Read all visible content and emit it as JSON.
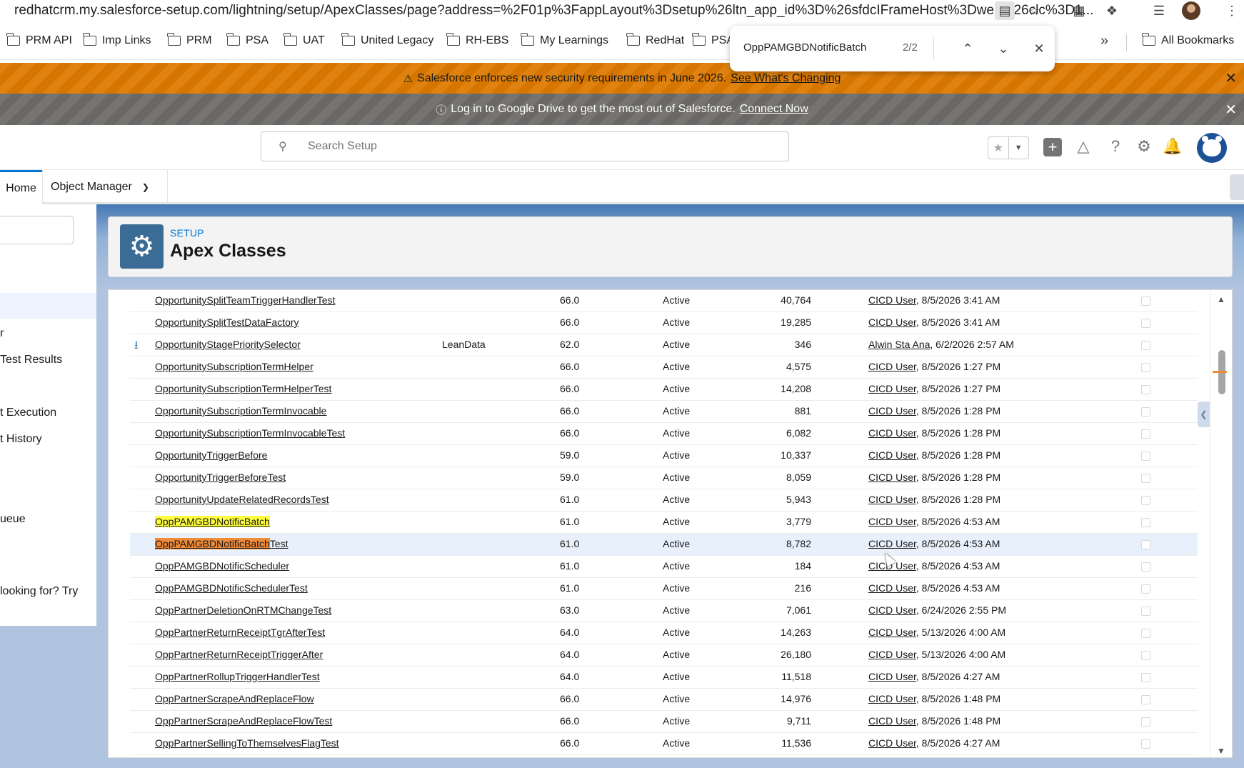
{
  "browser": {
    "url": "redhatcrm.my.salesforce-setup.com/lightning/setup/ApexClasses/page?address=%2F01p%3FappLayout%3Dsetup%26ltn_app_id%3D%26sfdcIFrameHost%3Dweb%26clc%3D1..."
  },
  "bookmarks": [
    "PRM API",
    "Imp Links",
    "PRM",
    "PSA",
    "UAT",
    "United Legacy",
    "RH-EBS",
    "My Learnings",
    "RedHat",
    "PSA"
  ],
  "bookmarks_overflow": "»",
  "all_bookmarks": "All Bookmarks",
  "find": {
    "term": "OppPAMGBDNotificBatch",
    "count": "2/2"
  },
  "banners": {
    "security": {
      "text": "Salesforce enforces new security requirements in June 2026.",
      "link": "See What's Changing"
    },
    "drive": {
      "text": "Log in to Google Drive to get the most out of Salesforce.",
      "link": "Connect Now"
    }
  },
  "header": {
    "search_placeholder": "Search Setup"
  },
  "nav": {
    "home": "Home",
    "object_manager": "Object Manager"
  },
  "sidebar": {
    "items": [
      "r",
      "Test Results",
      "t Execution",
      "t History",
      "ueue",
      " looking for? Try"
    ]
  },
  "page": {
    "eyebrow": "SETUP",
    "title": "Apex Classes"
  },
  "rows": [
    {
      "name": "OpportunitySplitTeamTriggerHandlerTest",
      "ns": "",
      "api": "66.0",
      "status": "Active",
      "size": "40,764",
      "user": "CICD User",
      "date": ", 8/5/2026 3:41 AM"
    },
    {
      "name": "OpportunitySplitTestDataFactory",
      "ns": "",
      "api": "66.0",
      "status": "Active",
      "size": "19,285",
      "user": "CICD User",
      "date": ", 8/5/2026 3:41 AM"
    },
    {
      "name": "OpportunityStagePrioritySelector",
      "ns": "LeanData",
      "api": "62.0",
      "status": "Active",
      "size": "346",
      "user": "Alwin Sta Ana",
      "date": ", 6/2/2026 2:57 AM",
      "icon": true
    },
    {
      "name": "OpportunitySubscriptionTermHelper",
      "ns": "",
      "api": "66.0",
      "status": "Active",
      "size": "4,575",
      "user": "CICD User",
      "date": ", 8/5/2026 1:27 PM"
    },
    {
      "name": "OpportunitySubscriptionTermHelperTest",
      "ns": "",
      "api": "66.0",
      "status": "Active",
      "size": "14,208",
      "user": "CICD User",
      "date": ", 8/5/2026 1:27 PM"
    },
    {
      "name": "OpportunitySubscriptionTermInvocable",
      "ns": "",
      "api": "66.0",
      "status": "Active",
      "size": "881",
      "user": "CICD User",
      "date": ", 8/5/2026 1:28 PM"
    },
    {
      "name": "OpportunitySubscriptionTermInvocableTest",
      "ns": "",
      "api": "66.0",
      "status": "Active",
      "size": "6,082",
      "user": "CICD User",
      "date": ", 8/5/2026 1:28 PM"
    },
    {
      "name": "OpportunityTriggerBefore",
      "ns": "",
      "api": "59.0",
      "status": "Active",
      "size": "10,337",
      "user": "CICD User",
      "date": ", 8/5/2026 1:28 PM"
    },
    {
      "name": "OpportunityTriggerBeforeTest",
      "ns": "",
      "api": "59.0",
      "status": "Active",
      "size": "8,059",
      "user": "CICD User",
      "date": ", 8/5/2026 1:28 PM"
    },
    {
      "name": "OpportunityUpdateRelatedRecordsTest",
      "ns": "",
      "api": "61.0",
      "status": "Active",
      "size": "5,943",
      "user": "CICD User",
      "date": ", 8/5/2026 1:28 PM"
    },
    {
      "name": "OppPAMGBDNotificBatch",
      "ns": "",
      "api": "61.0",
      "status": "Active",
      "size": "3,779",
      "user": "CICD User",
      "date": ", 8/5/2026 4:53 AM",
      "match": "other",
      "matched": "OppPAMGBDNotificBatch",
      "rest": ""
    },
    {
      "name": "OppPAMGBDNotificBatchTest",
      "ns": "",
      "api": "61.0",
      "status": "Active",
      "size": "8,782",
      "user": "CICD User",
      "date": ", 8/5/2026 4:53 AM",
      "match": "current",
      "matched": "OppPAMGBDNotificBatch",
      "rest": "Test",
      "hover": true
    },
    {
      "name": "OppPAMGBDNotificScheduler",
      "ns": "",
      "api": "61.0",
      "status": "Active",
      "size": "184",
      "user": "CICD User",
      "date": ", 8/5/2026 4:53 AM"
    },
    {
      "name": "OppPAMGBDNotificSchedulerTest",
      "ns": "",
      "api": "61.0",
      "status": "Active",
      "size": "216",
      "user": "CICD User",
      "date": ", 8/5/2026 4:53 AM"
    },
    {
      "name": "OppPartnerDeletionOnRTMChangeTest",
      "ns": "",
      "api": "63.0",
      "status": "Active",
      "size": "7,061",
      "user": "CICD User",
      "date": ", 6/24/2026 2:55 PM"
    },
    {
      "name": "OppPartnerReturnReceiptTgrAfterTest",
      "ns": "",
      "api": "64.0",
      "status": "Active",
      "size": "14,263",
      "user": "CICD User",
      "date": ", 5/13/2026 4:00 AM"
    },
    {
      "name": "OppPartnerReturnReceiptTriggerAfter",
      "ns": "",
      "api": "64.0",
      "status": "Active",
      "size": "26,180",
      "user": "CICD User",
      "date": ", 5/13/2026 4:00 AM"
    },
    {
      "name": "OppPartnerRollupTriggerHandlerTest",
      "ns": "",
      "api": "64.0",
      "status": "Active",
      "size": "11,518",
      "user": "CICD User",
      "date": ", 8/5/2026 4:27 AM"
    },
    {
      "name": "OppPartnerScrapeAndReplaceFlow",
      "ns": "",
      "api": "66.0",
      "status": "Active",
      "size": "14,976",
      "user": "CICD User",
      "date": ", 8/5/2026 1:48 PM"
    },
    {
      "name": "OppPartnerScrapeAndReplaceFlowTest",
      "ns": "",
      "api": "66.0",
      "status": "Active",
      "size": "9,711",
      "user": "CICD User",
      "date": ", 8/5/2026 1:48 PM"
    },
    {
      "name": "OppPartnerSellingToThemselvesFlagTest",
      "ns": "",
      "api": "66.0",
      "status": "Active",
      "size": "11,536",
      "user": "CICD User",
      "date": ", 8/5/2026 4:27 AM"
    }
  ],
  "colors": {
    "find_current": "#f08b38",
    "find_other": "#ffff3f",
    "security_banner": "#dd7a01",
    "info_banner": "#706e6b",
    "brand_blue": "#0176d3"
  }
}
